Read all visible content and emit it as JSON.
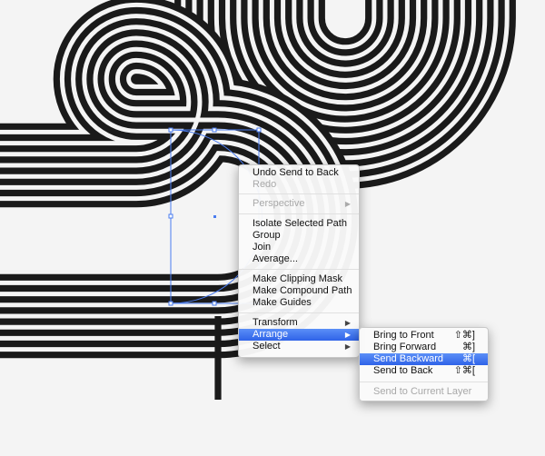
{
  "colors": {
    "stripe": "#1a1a1a",
    "background": "#f4f4f4",
    "selection": "#4a7cf0",
    "highlight": "#3a6ef0"
  },
  "context_menu": {
    "items": [
      {
        "label": "Undo Send to Back",
        "enabled": true
      },
      {
        "label": "Redo",
        "enabled": false
      },
      {
        "label": "Perspective",
        "enabled": false,
        "submenu": true
      },
      {
        "label": "Isolate Selected Path",
        "enabled": true
      },
      {
        "label": "Group",
        "enabled": true
      },
      {
        "label": "Join",
        "enabled": true
      },
      {
        "label": "Average...",
        "enabled": true
      },
      {
        "label": "Make Clipping Mask",
        "enabled": true
      },
      {
        "label": "Make Compound Path",
        "enabled": true
      },
      {
        "label": "Make Guides",
        "enabled": true
      },
      {
        "label": "Transform",
        "enabled": true,
        "submenu": true
      },
      {
        "label": "Arrange",
        "enabled": true,
        "submenu": true,
        "highlighted": true
      },
      {
        "label": "Select",
        "enabled": true,
        "submenu": true
      }
    ],
    "arrow": "▶"
  },
  "arrange_submenu": {
    "items": [
      {
        "label": "Bring to Front",
        "shortcut": "⇧⌘]"
      },
      {
        "label": "Bring Forward",
        "shortcut": "⌘]"
      },
      {
        "label": "Send Backward",
        "shortcut": "⌘[",
        "highlighted": true
      },
      {
        "label": "Send to Back",
        "shortcut": "⇧⌘["
      },
      {
        "label": "Send to Current Layer",
        "shortcut": "",
        "enabled": false
      }
    ]
  }
}
